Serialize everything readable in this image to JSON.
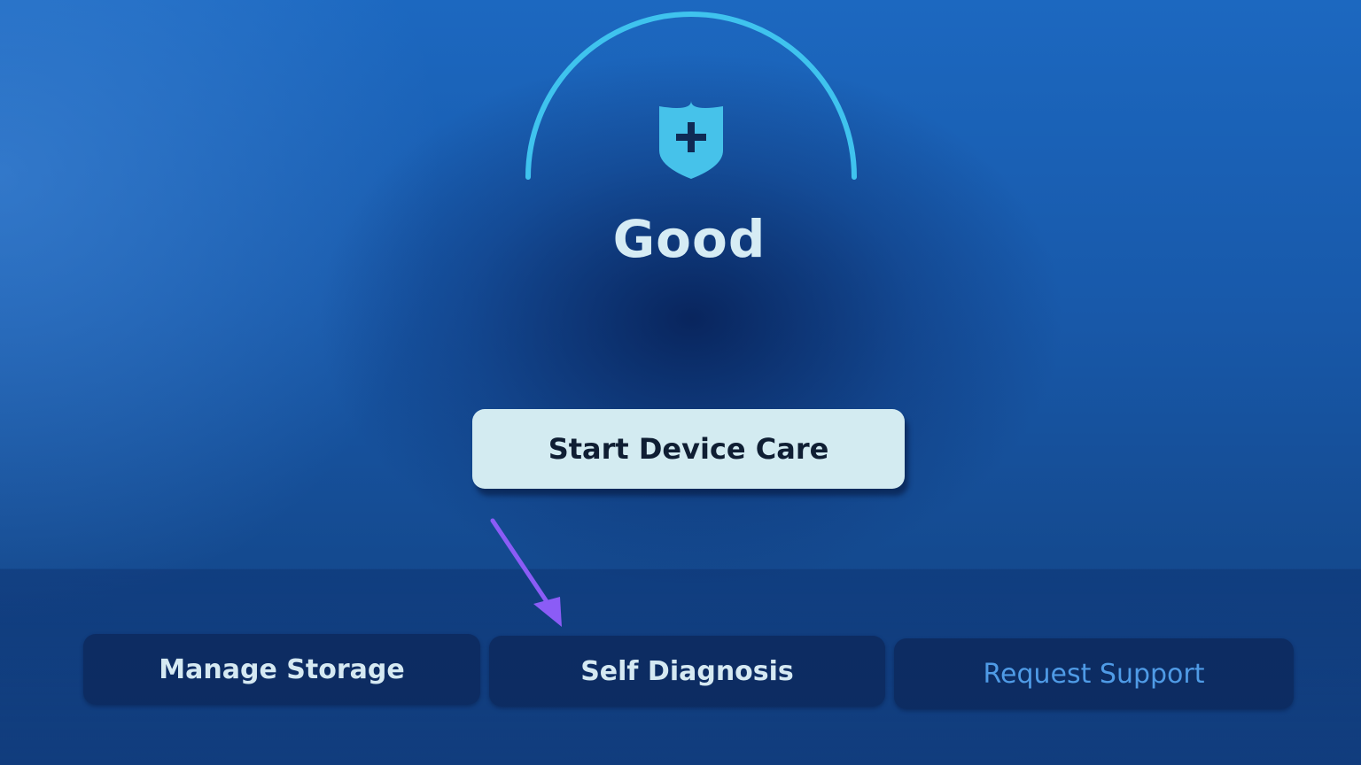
{
  "status": {
    "label": "Good",
    "icon": "shield-plus-icon"
  },
  "primary_action": {
    "label": "Start Device Care"
  },
  "menu": {
    "items": [
      {
        "label": "Manage Storage"
      },
      {
        "label": "Self Diagnosis"
      },
      {
        "label": "Request Support"
      }
    ]
  },
  "colors": {
    "gauge_arc": "#3fc3ee",
    "shield": "#46c2ea",
    "annotation_arrow": "#8b5cf6",
    "primary_button": "#d3ebf1"
  }
}
